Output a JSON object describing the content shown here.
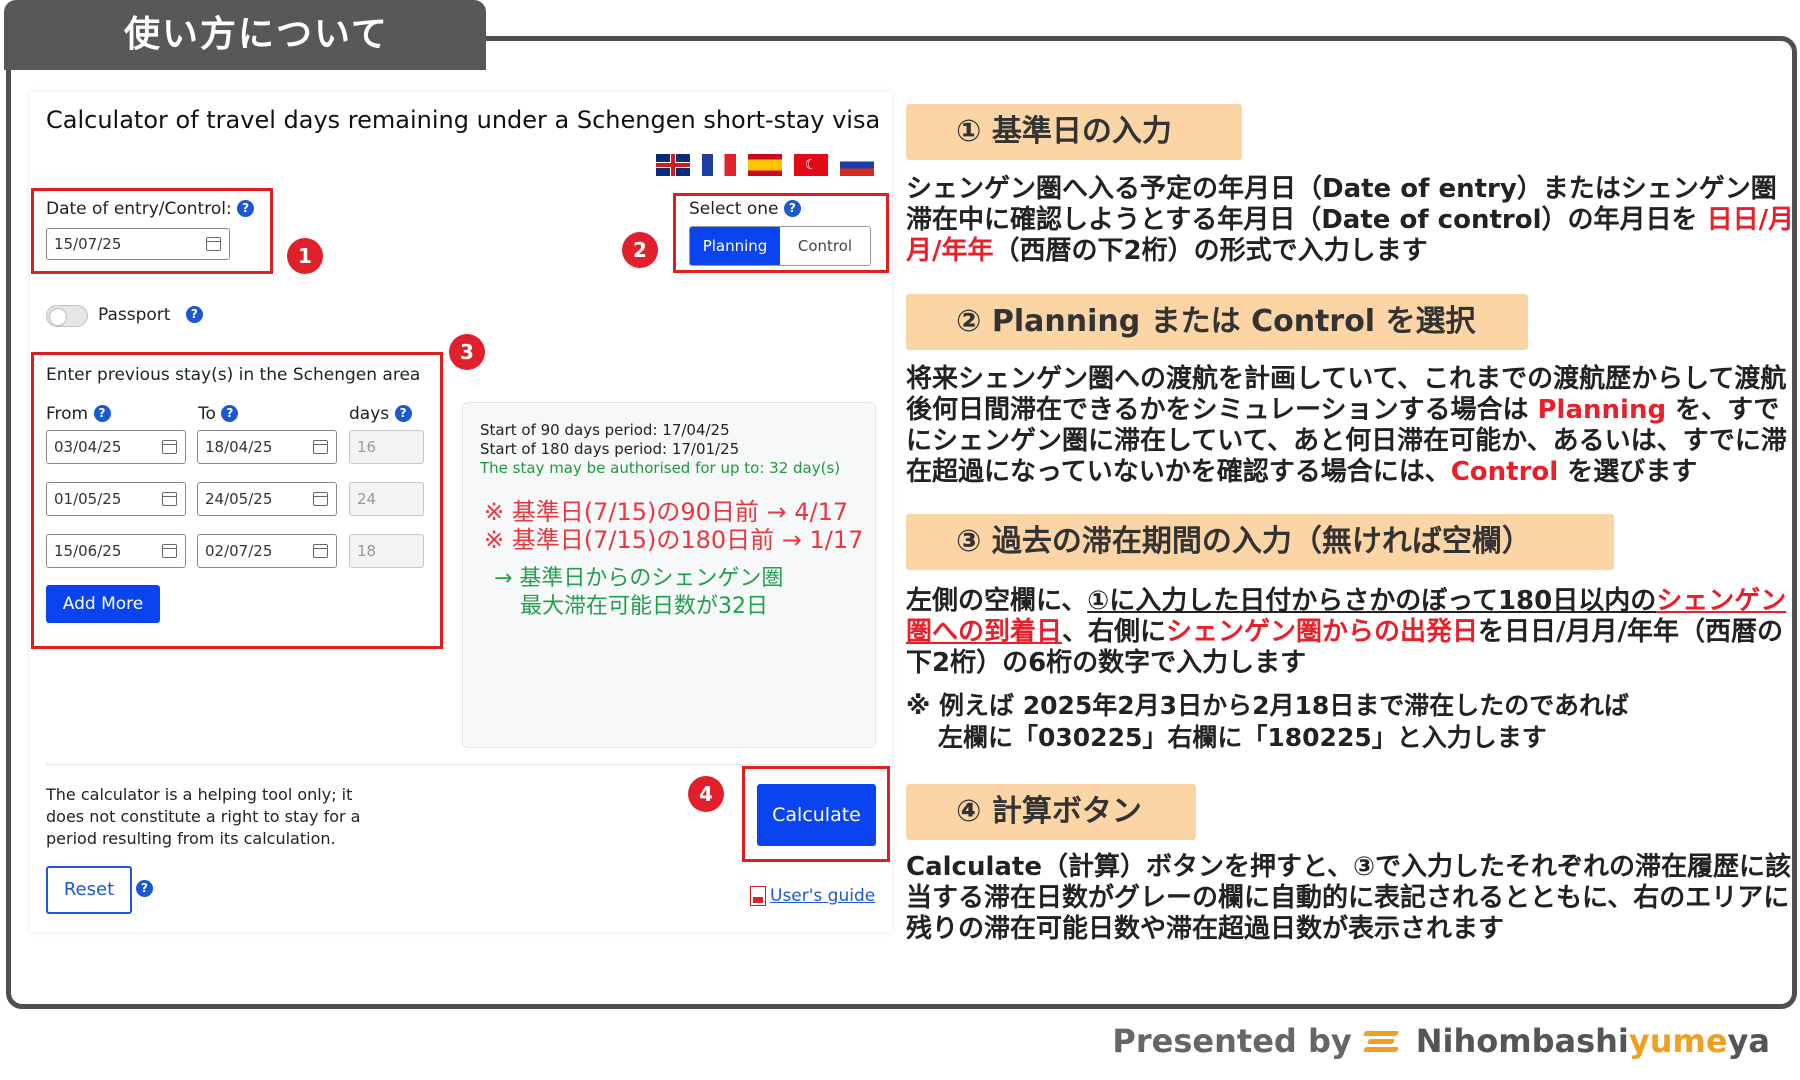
{
  "header": {
    "tab_title": "使い方について"
  },
  "calculator": {
    "title": "Calculator of travel days remaining under a Schengen short-stay visa",
    "flags": [
      "uk-flag-icon",
      "fr-flag-icon",
      "es-flag-icon",
      "tr-flag-icon",
      "ru-flag-icon"
    ],
    "date_label": "Date of entry/Control:",
    "date_value": "15/07/25",
    "select_one_label": "Select one",
    "mode_planning": "Planning",
    "mode_control": "Control",
    "passport_label": "Passport",
    "stays_title": "Enter previous stay(s) in the Schengen area",
    "col_from": "From",
    "col_to": "To",
    "col_days": "days",
    "stays": [
      {
        "from": "03/04/25",
        "to": "18/04/25",
        "days": "16"
      },
      {
        "from": "01/05/25",
        "to": "24/05/25",
        "days": "24"
      },
      {
        "from": "15/06/25",
        "to": "02/07/25",
        "days": "18"
      }
    ],
    "add_more": "Add More",
    "result_line1": "Start of 90 days period: 17/04/25",
    "result_line2": "Start of 180 days period: 17/01/25",
    "result_line3": "The stay may be authorised for up to: 32 day(s)",
    "annot_red1": "※ 基準日(7/15)の90日前 → 4/17",
    "annot_red2": "※ 基準日(7/15)の180日前 → 1/17",
    "annot_green1": "→ 基準日からのシェンゲン圏",
    "annot_green2": "最大滞在可能日数が32日",
    "disclaimer": "The calculator is a helping tool only; it does not constitute a right to stay for a period resulting from its calculation.",
    "calculate": "Calculate",
    "reset": "Reset",
    "guide": "User's guide",
    "badges": [
      "1",
      "2",
      "3",
      "4"
    ]
  },
  "steps": [
    {
      "title": "① 基準日の入力"
    },
    {
      "title": "② Planning または Control を選択"
    },
    {
      "title": "③ 過去の滞在期間の入力（無ければ空欄）"
    },
    {
      "title": "④ 計算ボタン"
    }
  ],
  "step1_desc": {
    "a": "シェンゲン圏へ入る予定の年月日（Date of entry）またはシェンゲン圏滞在中に確認しようとする年月日（Date of control）の年月日を ",
    "b": "日日/月月/年年",
    "c": "（西暦の下2桁）の形式で入力します"
  },
  "step2_desc": {
    "a": "将来シェンゲン圏への渡航を計画していて、これまでの渡航歴からして渡航後何日間滞在できるかをシミュレーションする場合は ",
    "b": "Planning",
    "c": " を、すでにシェンゲン圏に滞在していて、あと何日滞在可能か、あるいは、すでに滞在超過になっていないかを確認する場合には、",
    "d": "Control",
    "e": " を選びます"
  },
  "step3_desc": {
    "a": "左側の空欄に、",
    "b": "①に入力した日付からさかのぼって180日以内の",
    "c": "シェンゲン圏への到着日",
    "d": "、右側に",
    "e": "シェンゲン圏からの出発日",
    "f": "を日日/月月/年年（西暦の下2桁）の6桁の数字で入力します",
    "note1": "※ 例えば 2025年2月3日から2月18日まで滞在したのであれば",
    "note2": "左欄に「030225」右欄に「180225」と入力します"
  },
  "step4_desc": "Calculate（計算）ボタンを押すと、③で入力したそれぞれの滞在履歴に該当する滞在日数がグレーの欄に自動的に表記されるとともに、右のエリアに残りの滞在可能日数や滞在超過日数が表示されます",
  "footer": {
    "presented_by": "Presented by",
    "brand_a": "Nihombashi",
    "brand_b": "yume",
    "brand_c": "ya"
  },
  "colors": {
    "accent_blue": "#0a43f0",
    "highlight_red": "#e02020",
    "step_bg": "#fbd5a5",
    "frame": "#4f4f4f"
  }
}
